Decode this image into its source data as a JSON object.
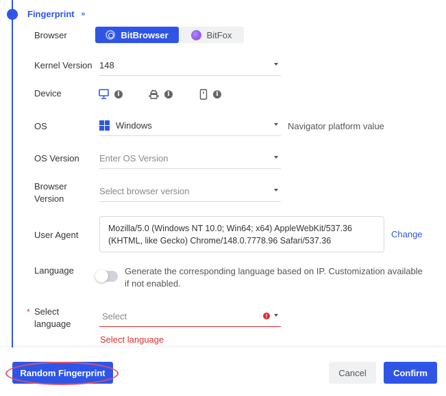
{
  "section": {
    "title": "Fingerprint",
    "chevron": "»"
  },
  "browser": {
    "label": "Browser",
    "options": [
      {
        "label": "BitBrowser",
        "icon": "bitbrowser-logo-icon",
        "active": true
      },
      {
        "label": "BitFox",
        "icon": "bitfox-logo-icon",
        "active": false
      }
    ]
  },
  "kernel": {
    "label": "Kernel Version",
    "value": "148"
  },
  "device": {
    "label": "Device",
    "icons": [
      "desktop-icon",
      "android-icon",
      "mobile-icon"
    ],
    "info_glyph": "i"
  },
  "os": {
    "label": "OS",
    "value": "Windows",
    "helper": "Navigator platform value",
    "icon": "windows-icon"
  },
  "os_version": {
    "label": "OS Version",
    "placeholder": "Enter OS Version"
  },
  "browser_version": {
    "label_line1": "Browser",
    "label_line2": "Version",
    "placeholder": "Select browser version"
  },
  "user_agent": {
    "label": "User Agent",
    "line1": "Mozilla/5.0 (Windows NT 10.0; Win64; x64) AppleWebKit/537.36",
    "line2": "(KHTML, like Gecko) Chrome/148.0.7778.96 Safari/537.36",
    "change_label": "Change"
  },
  "language": {
    "label": "Language",
    "toggle_on": false,
    "description_line1": "Generate the corresponding language based on IP. Customization available",
    "description_line2": "if not enabled."
  },
  "select_language": {
    "required_mark": "*",
    "label_line1": "Select",
    "label_line2": "language",
    "placeholder": "Select",
    "error_glyph": "!",
    "error": "Select language"
  },
  "footer": {
    "random_label": "Random Fingerprint",
    "cancel_label": "Cancel",
    "confirm_label": "Confirm"
  },
  "colors": {
    "accent": "#2f55e6",
    "error": "#e02d2d",
    "highlight": "#e05565"
  }
}
